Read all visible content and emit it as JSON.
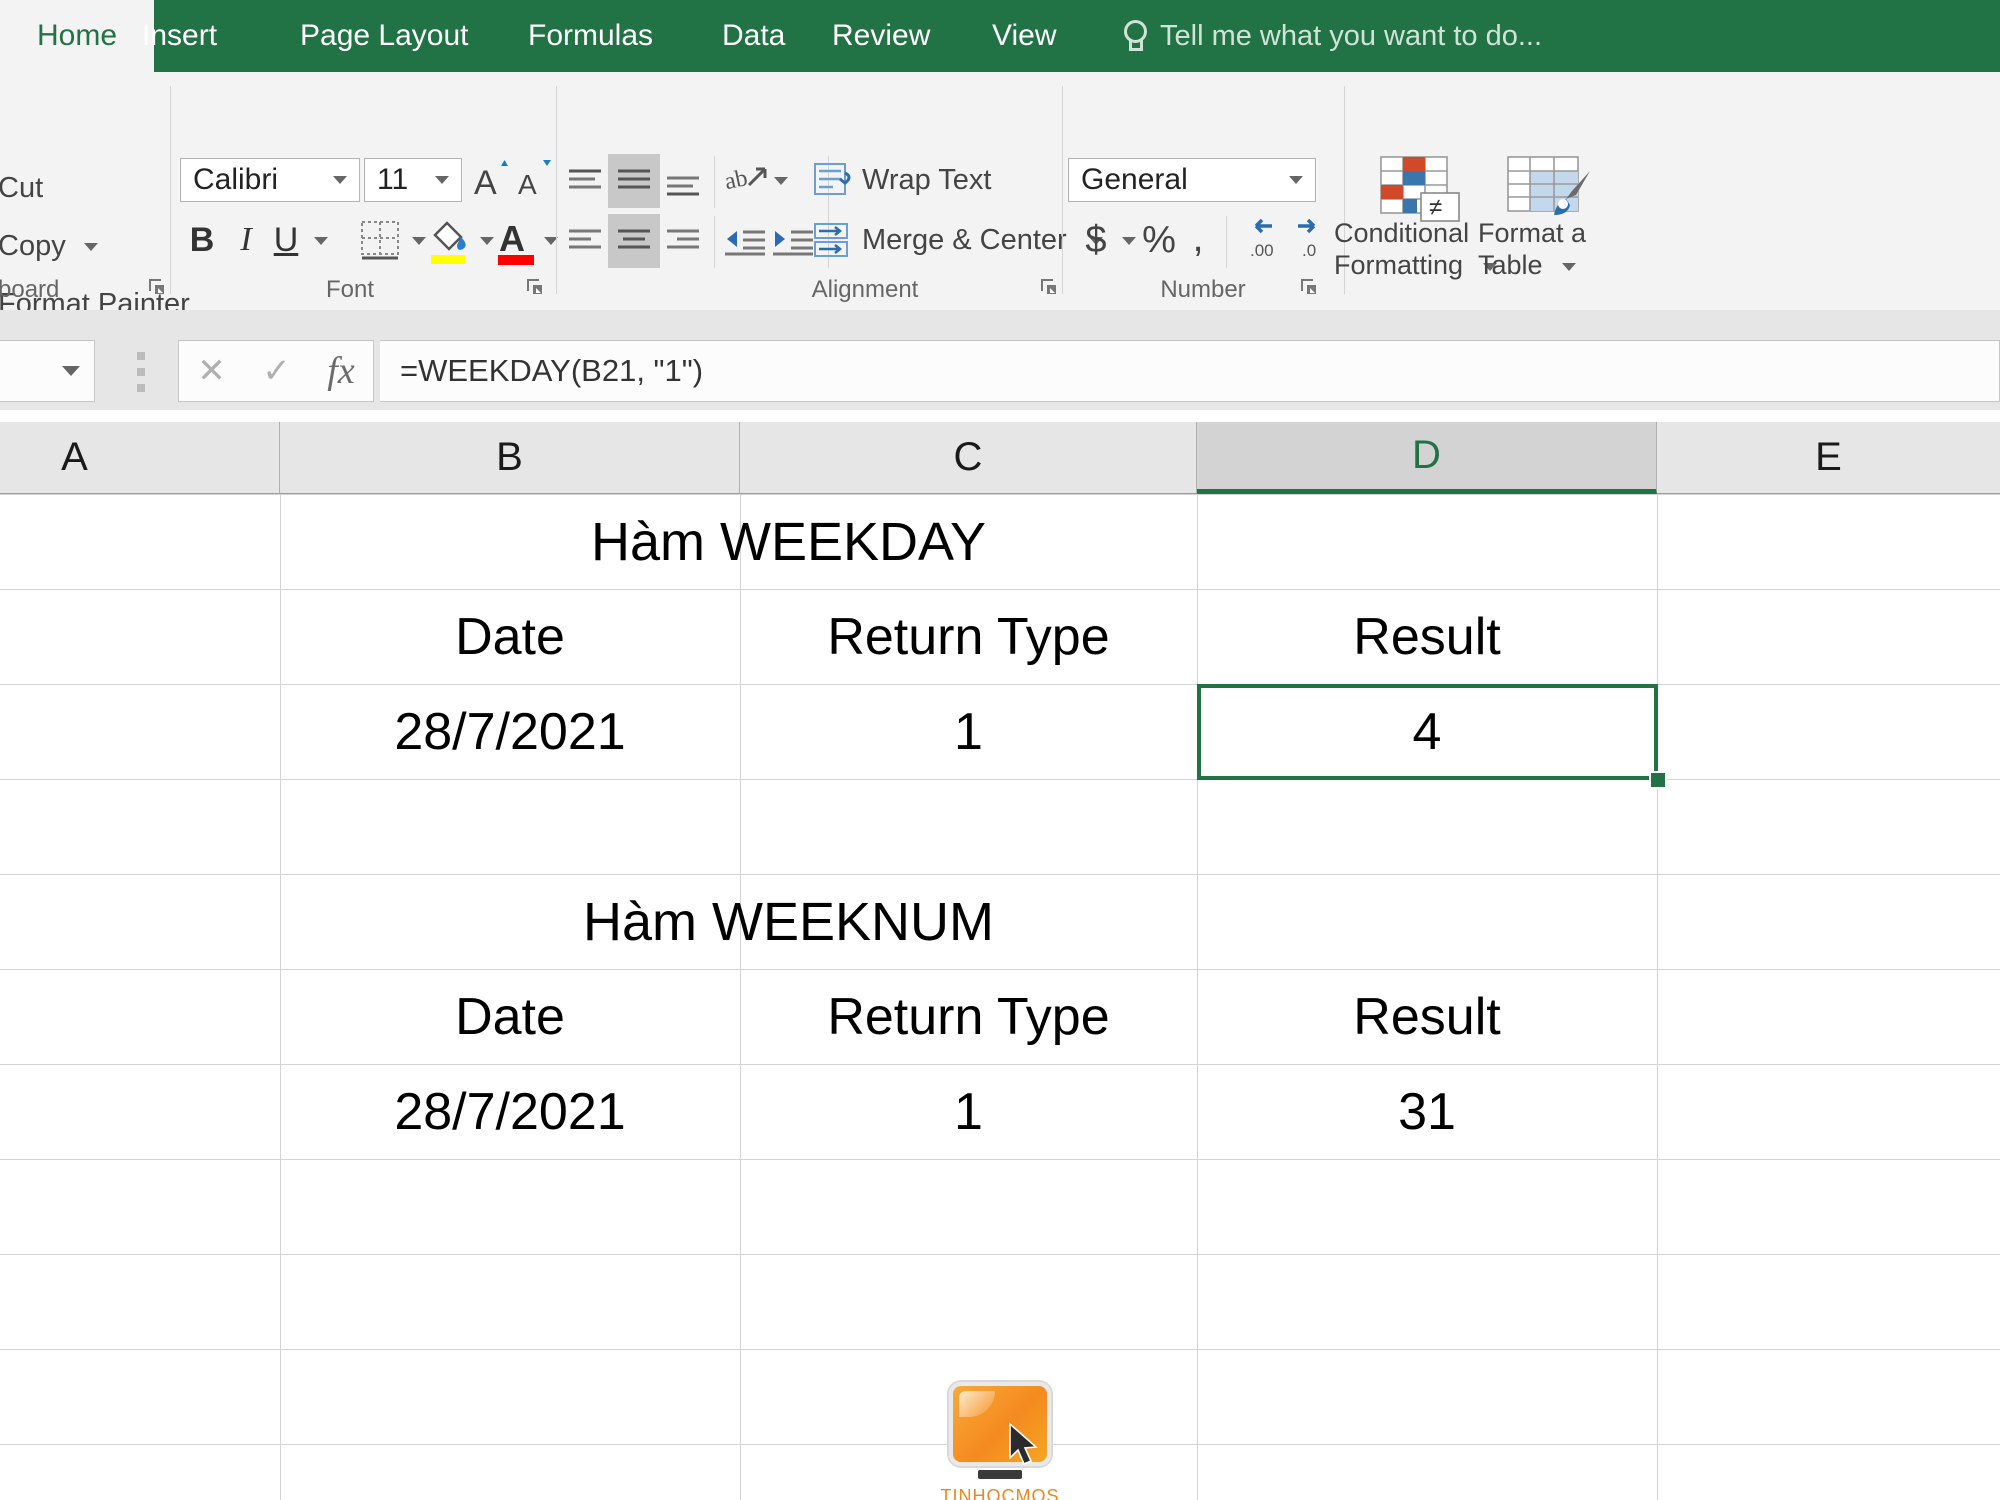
{
  "ribbon": {
    "tabs": [
      {
        "label": "Home",
        "active": true
      },
      {
        "label": "Insert",
        "active": false
      },
      {
        "label": "Page Layout",
        "active": false
      },
      {
        "label": "Formulas",
        "active": false
      },
      {
        "label": "Data",
        "active": false
      },
      {
        "label": "Review",
        "active": false
      },
      {
        "label": "View",
        "active": false
      }
    ],
    "tell_me": "Tell me what you want to do...",
    "groups": {
      "clipboard": {
        "label": "board",
        "cut": "Cut",
        "copy": "Copy",
        "format_painter": "Format Painter"
      },
      "font": {
        "label": "Font",
        "font_name": "Calibri",
        "font_size": "11"
      },
      "alignment": {
        "label": "Alignment",
        "wrap_text": "Wrap Text",
        "merge_center": "Merge & Center"
      },
      "number": {
        "label": "Number",
        "format": "General",
        "currency": "$",
        "percent": "%",
        "comma": ","
      },
      "styles": {
        "conditional_formatting_line1": "Conditional",
        "conditional_formatting_line2": "Formatting",
        "format_as_table_line1": "Format a",
        "format_as_table_line2": "Table"
      }
    }
  },
  "formula_bar": {
    "name_box_value": "",
    "formula": "=WEEKDAY(B21, \"1\")",
    "cancel_icon": "✕",
    "enter_icon": "✓",
    "fx_icon": "fx"
  },
  "sheet": {
    "columns": [
      {
        "label": "A",
        "active": false
      },
      {
        "label": "B",
        "active": false
      },
      {
        "label": "C",
        "active": false
      },
      {
        "label": "D",
        "active": true
      },
      {
        "label": "E",
        "active": false
      }
    ],
    "selected_cell": "D21",
    "cells": {
      "weekday_title": "Hàm WEEKDAY",
      "weekday_hdr_date": "Date",
      "weekday_hdr_return_type": "Return Type",
      "weekday_hdr_result": "Result",
      "weekday_date": "28/7/2021",
      "weekday_return_type": "1",
      "weekday_result": "4",
      "weeknum_title": "Hàm WEEKNUM",
      "weeknum_hdr_date": "Date",
      "weeknum_hdr_return_type": "Return Type",
      "weeknum_hdr_result": "Result",
      "weeknum_date": "28/7/2021",
      "weeknum_return_type": "1",
      "weeknum_result": "31"
    }
  },
  "watermark": {
    "label": "TINHOCMOS"
  },
  "colors": {
    "excel_green": "#217346",
    "selection_green": "#217346",
    "ribbon_bg": "#f3f3f3",
    "header_bg": "#e6e6e6",
    "gridline": "#d4d4d4",
    "highlight_yellow": "#ffff00",
    "font_color_red": "#ff0000",
    "watermark_orange": "#f0871e"
  }
}
